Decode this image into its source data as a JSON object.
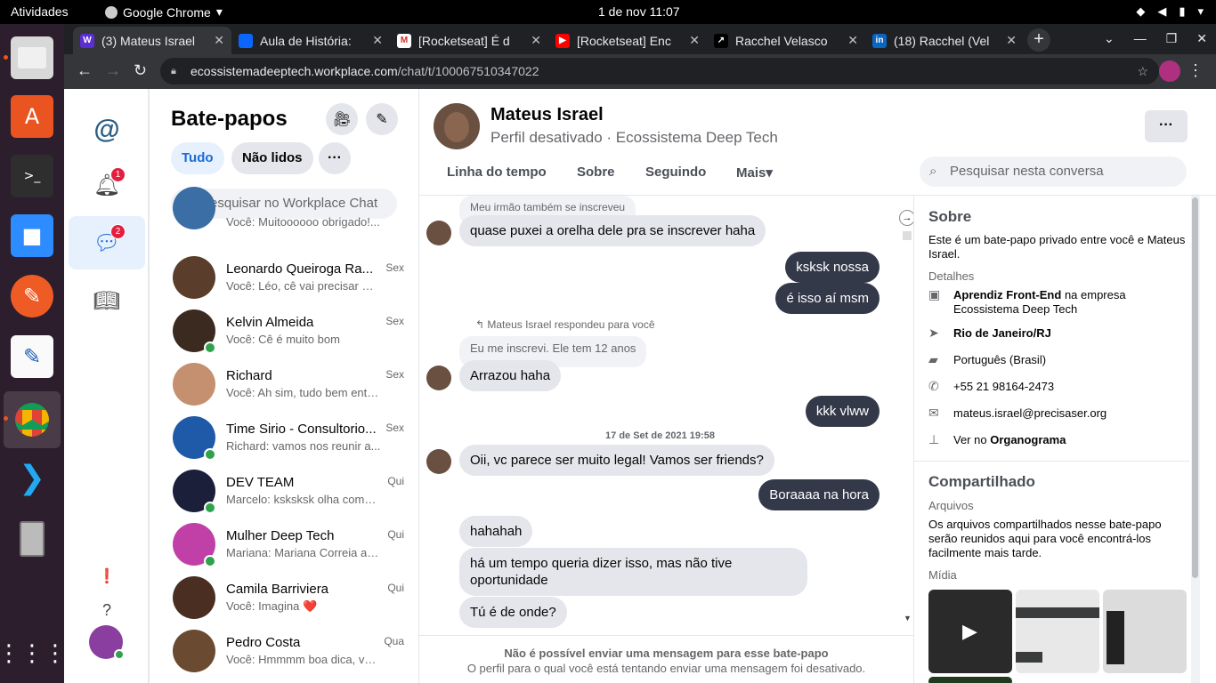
{
  "topbar": {
    "activities": "Atividades",
    "app": "Google Chrome",
    "clock": "1 de nov  11:07"
  },
  "dock": {
    "apps": [
      "files-icon",
      "app-center-icon",
      "terminal-icon",
      "zoom-icon",
      "postman-icon",
      "text-editor-icon",
      "chrome-icon",
      "vscode-icon",
      "removable-drive-icon",
      "show-apps-icon"
    ]
  },
  "browser": {
    "tabs": [
      {
        "title": "(3) Mateus Israel",
        "favicon": "W",
        "color": "#5b2dd4"
      },
      {
        "title": "Aula de História:",
        "favicon": "◣",
        "color": "#0b66ff"
      },
      {
        "title": "[Rocketseat] É d",
        "favicon": "M",
        "color": "#d93025"
      },
      {
        "title": "[Rocketseat] Enc",
        "favicon": "▶",
        "color": "#ff0000"
      },
      {
        "title": "Racchel Velasco",
        "favicon": "↗",
        "color": "#000000"
      },
      {
        "title": "(18) Racchel (Vel",
        "favicon": "in",
        "color": "#0a66c2"
      }
    ],
    "url_host": "ecossistemadeeptech.workplace.com",
    "url_path": "/chat/t/100067510347022"
  },
  "leftnav": {
    "notif_badge": "1",
    "chat_badge": "2"
  },
  "chatlist": {
    "title": "Bate-papos",
    "filters": {
      "all": "Tudo",
      "unread": "Não lidos"
    },
    "search_placeholder": "Pesquisar no Workplace Chat",
    "items": [
      {
        "name": "",
        "time": "",
        "preview": "Você: Muitoooooo obrigado!...",
        "online": false,
        "color": "#3a6ea5"
      },
      {
        "name": "Leonardo Queiroga Ra...",
        "time": "Sex",
        "preview": "Você: Léo, cê vai precisar m...",
        "online": false,
        "color": "#5a3d2b"
      },
      {
        "name": "Kelvin Almeida",
        "time": "Sex",
        "preview": "Você: Cê é muito bom",
        "online": true,
        "color": "#3b2a1f"
      },
      {
        "name": "Richard",
        "time": "Sex",
        "preview": "Você: Ah sim, tudo bem enten...",
        "online": false,
        "color": "#c49070"
      },
      {
        "name": "Time Sirio - Consultorio...",
        "time": "Sex",
        "preview": "Richard: vamos nos reunir a...",
        "online": true,
        "color": "#1e5aa8"
      },
      {
        "name": "DEV TEAM",
        "time": "Qui",
        "preview": "Marcelo: ksksksk olha como ...",
        "online": true,
        "color": "#1b1f3a"
      },
      {
        "name": "Mulher Deep Tech",
        "time": "Qui",
        "preview": "Mariana: Mariana Correia adi...",
        "online": true,
        "color": "#c040a8"
      },
      {
        "name": "Camila Barriviera",
        "time": "Qui",
        "preview": "Você: Imagina ❤️",
        "online": false,
        "color": "#4a2e22"
      },
      {
        "name": "Pedro Costa",
        "time": "Qua",
        "preview": "Você: Hmmmm boa dica, val...",
        "online": false,
        "color": "#6a4a30"
      }
    ]
  },
  "chat": {
    "name": "Mateus Israel",
    "subtitle": "Perfil desativado · Ecossistema Deep Tech",
    "tabs": [
      "Linha do tempo",
      "Sobre",
      "Seguindo",
      "Mais"
    ],
    "search_placeholder": "Pesquisar nesta conversa",
    "messages": {
      "reply1": "Meu irmão também se inscreveu",
      "m1": "quase puxei a orelha dele pra se inscrever haha",
      "m2": "ksksk nossa",
      "m3": "é isso aí msm",
      "replied_note": "Mateus Israel respondeu para você",
      "reply2": "Eu me inscrevi. Ele tem 12 anos",
      "m4": "Arrazou haha",
      "m5": "kkk vlww",
      "date": "17 de Set de 2021 19:58",
      "m6": "Oii, vc parece ser muito legal! Vamos ser friends?",
      "m7": "Boraaaa na hora",
      "m8": "hahahah",
      "m9": "há um tempo queria dizer isso, mas não tive oportunidade",
      "m10": "Tú é de onde?"
    },
    "footer_title": "Não é possível enviar uma mensagem para esse bate-papo",
    "footer_text": "O perfil para o qual você está tentando enviar uma mensagem foi desativado."
  },
  "about": {
    "title": "Sobre",
    "text": "Este é um bate-papo privado entre você e Mateus Israel.",
    "details_label": "Detalhes",
    "job_role": "Aprendiz Front-End",
    "job_mid": " na empresa ",
    "job_company": "Ecossistema Deep Tech",
    "location": "Rio de Janeiro/RJ",
    "language": "Português (Brasil)",
    "phone": "+55 21 98164-2473",
    "email": "mateus.israel@precisaser.org",
    "org_prefix": "Ver no ",
    "org_link": "Organograma",
    "shared_title": "Compartilhado",
    "files_label": "Arquivos",
    "files_text": "Os arquivos compartilhados nesse bate-papo serão reunidos aqui para você encontrá-los facilmente mais tarde.",
    "media_label": "Mídia"
  }
}
